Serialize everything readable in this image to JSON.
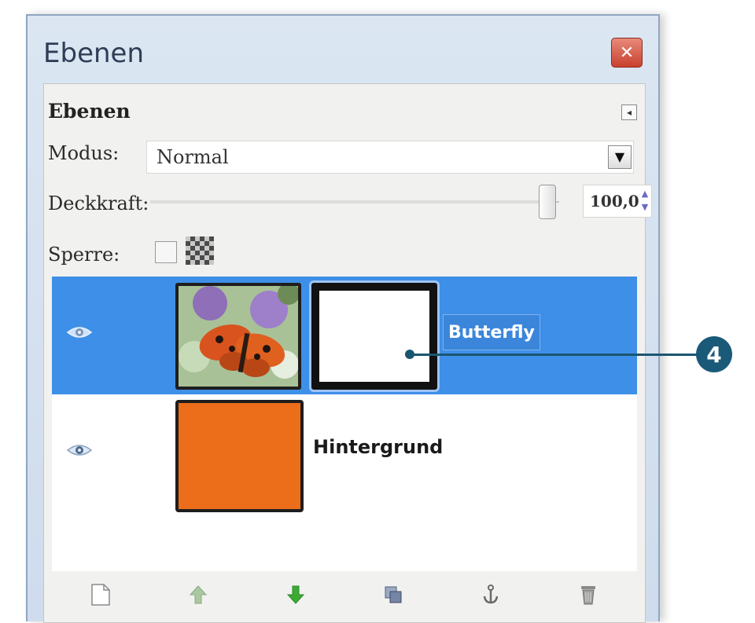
{
  "window": {
    "title": "Ebenen",
    "close_icon": "close-icon",
    "close_symbol": "✕"
  },
  "panel": {
    "title": "Ebenen",
    "menu_symbol": "◂",
    "mode": {
      "label": "Modus:",
      "value": "Normal",
      "arrow": "▼"
    },
    "opacity": {
      "label": "Deckkraft:",
      "value": "100,0",
      "value_fraction": 1.0,
      "spin_up": "▲",
      "spin_down": "▼"
    },
    "lock": {
      "label": "Sperre:",
      "pixels_checked": false
    }
  },
  "layers": [
    {
      "name": "Butterfly",
      "visible": true,
      "selected": true,
      "has_mask": true
    },
    {
      "name": "Hintergrund",
      "visible": true,
      "selected": false,
      "fill_color": "#ec6d1a"
    }
  ],
  "toolbar": {
    "icons": [
      "new-layer-icon",
      "raise-layer-icon",
      "lower-layer-icon",
      "duplicate-layer-icon",
      "anchor-layer-icon",
      "delete-layer-icon"
    ]
  },
  "callout": {
    "number": "4"
  },
  "colors": {
    "selection": "#3e8fe7",
    "callout": "#1a5a78",
    "background_layer": "#ec6d1a"
  }
}
